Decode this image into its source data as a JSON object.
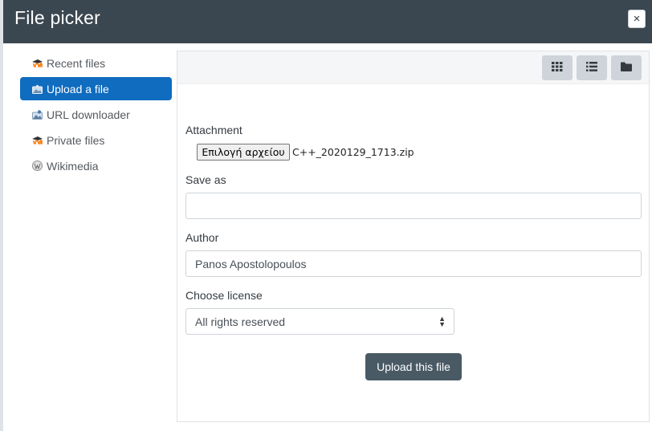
{
  "dialog": {
    "title": "File picker",
    "close_label": "×"
  },
  "sidebar": {
    "items": [
      {
        "label": "Recent files",
        "icon": "moodle-icon",
        "active": false
      },
      {
        "label": "Upload a file",
        "icon": "upload-icon",
        "active": true
      },
      {
        "label": "URL downloader",
        "icon": "download-icon",
        "active": false
      },
      {
        "label": "Private files",
        "icon": "moodle-icon",
        "active": false
      },
      {
        "label": "Wikimedia",
        "icon": "wikimedia-icon",
        "active": false
      }
    ]
  },
  "toolbar": {
    "views": [
      "grid-view-icon",
      "list-view-icon",
      "folder-view-icon"
    ]
  },
  "form": {
    "attachment_label": "Attachment",
    "choose_file_label": "Επιλογή αρχείου",
    "file_name": "C++_2020129_1713.zip",
    "save_as_label": "Save as",
    "save_as_value": "",
    "author_label": "Author",
    "author_value": "Panos Apostolopoulos",
    "license_label": "Choose license",
    "license_value": "All rights reserved",
    "upload_button": "Upload this file"
  },
  "colors": {
    "header": "#3b4750",
    "active": "#0f6cbf",
    "upload_button": "#495a65"
  }
}
